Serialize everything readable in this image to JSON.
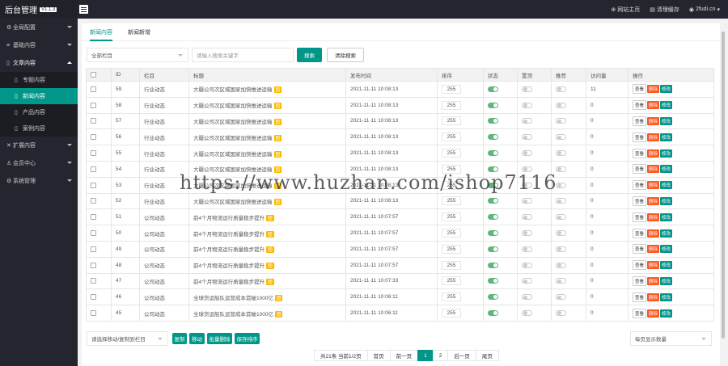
{
  "header": {
    "logo_text": "后台管理",
    "version": "V1.1.3",
    "links": [
      {
        "icon": "globe-icon",
        "label": "网站主页"
      },
      {
        "icon": "clear-icon",
        "label": "清理缓存"
      },
      {
        "icon": "user-icon",
        "label": "2fudi.cn"
      }
    ]
  },
  "sidebar": {
    "items": [
      {
        "icon": "gear-icon",
        "label": "全局配置"
      },
      {
        "icon": "sliders-icon",
        "label": "基础内容"
      },
      {
        "icon": "document-icon",
        "label": "文章内容"
      },
      {
        "icon": "expand-icon",
        "label": "扩展内容"
      },
      {
        "icon": "member-icon",
        "label": "会员中心"
      },
      {
        "icon": "settings-icon",
        "label": "系统管理"
      }
    ],
    "sub_items": [
      "专题内容",
      "新闻内容",
      "产品内容",
      "案例内容"
    ]
  },
  "tabs": [
    "新闻内容",
    "新闻新增"
  ],
  "filter": {
    "category_select": "全部栏目",
    "search_placeholder": "请输入搜索关键字",
    "search_button": "搜索",
    "clear_button": "清除搜索"
  },
  "table": {
    "headers": [
      "",
      "ID",
      "栏目",
      "标题",
      "发布时间",
      "排序",
      "状态",
      "置顶",
      "推荐",
      "访问量",
      "操作"
    ],
    "rows": [
      {
        "id": "59",
        "cat": "行业动态",
        "title": "大疆公司次区域国家加快推进运输",
        "time": "2021-11-11 10:08:13",
        "sort": "255",
        "status": "on",
        "top": "off",
        "rec": "off",
        "views": "11"
      },
      {
        "id": "58",
        "cat": "行业动态",
        "title": "大疆公司次区域国家加快推进运输",
        "time": "2021-11-11 10:08:13",
        "sort": "255",
        "status": "on",
        "top": "off",
        "rec": "off",
        "views": "0"
      },
      {
        "id": "57",
        "cat": "行业动态",
        "title": "大疆公司次区域国家加快推进运输",
        "time": "2021-11-11 10:08:13",
        "sort": "255",
        "status": "on",
        "top": "off",
        "rec": "off",
        "views": "0"
      },
      {
        "id": "56",
        "cat": "行业动态",
        "title": "大疆公司次区域国家加快推进运输",
        "time": "2021-11-11 10:08:13",
        "sort": "255",
        "status": "on",
        "top": "off",
        "rec": "off",
        "views": "0"
      },
      {
        "id": "55",
        "cat": "行业动态",
        "title": "大疆公司次区域国家加快推进运输",
        "time": "2021-11-11 10:08:13",
        "sort": "255",
        "status": "on",
        "top": "off",
        "rec": "off",
        "views": "0"
      },
      {
        "id": "54",
        "cat": "行业动态",
        "title": "大疆公司次区域国家加快推进运输",
        "time": "2021-11-11 10:08:13",
        "sort": "255",
        "status": "on",
        "top": "off",
        "rec": "off",
        "views": "0"
      },
      {
        "id": "53",
        "cat": "行业动态",
        "title": "大疆公司次区域国家加快推进运输",
        "time": "2021-11-11 10:08:13",
        "sort": "255",
        "status": "on",
        "top": "off",
        "rec": "off",
        "views": "0"
      },
      {
        "id": "52",
        "cat": "行业动态",
        "title": "大疆公司次区域国家加快推进运输",
        "time": "2021-11-11 10:08:13",
        "sort": "255",
        "status": "on",
        "top": "off",
        "rec": "off",
        "views": "0"
      },
      {
        "id": "51",
        "cat": "公司动态",
        "title": "前4个月物流运行质量稳步提升",
        "time": "2021-11-11 10:07:57",
        "sort": "255",
        "status": "on",
        "top": "off",
        "rec": "off",
        "views": "0"
      },
      {
        "id": "50",
        "cat": "公司动态",
        "title": "前4个月物流运行质量稳步提升",
        "time": "2021-11-11 10:07:57",
        "sort": "255",
        "status": "on",
        "top": "off",
        "rec": "off",
        "views": "0"
      },
      {
        "id": "49",
        "cat": "公司动态",
        "title": "前4个月物流运行质量稳步提升",
        "time": "2021-11-11 10:07:57",
        "sort": "255",
        "status": "on",
        "top": "off",
        "rec": "off",
        "views": "0"
      },
      {
        "id": "48",
        "cat": "公司动态",
        "title": "前4个月物流运行质量稳步提升",
        "time": "2021-11-11 10:07:57",
        "sort": "255",
        "status": "on",
        "top": "off",
        "rec": "off",
        "views": "0"
      },
      {
        "id": "47",
        "cat": "公司动态",
        "title": "前4个月物流运行质量稳步提升",
        "time": "2021-11-11 10:07:33",
        "sort": "255",
        "status": "on",
        "top": "off",
        "rec": "off",
        "views": "0"
      },
      {
        "id": "46",
        "cat": "公司动态",
        "title": "全球货运船队运营成本首破1000亿",
        "time": "2021-11-11 10:06:11",
        "sort": "255",
        "status": "on",
        "top": "off",
        "rec": "off",
        "views": "0"
      },
      {
        "id": "45",
        "cat": "公司动态",
        "title": "全球货运船队运营成本首破1000亿",
        "time": "2021-11-11 10:06:11",
        "sort": "255",
        "status": "on",
        "top": "off",
        "rec": "off",
        "views": "0"
      }
    ],
    "badge": "图",
    "actions": [
      "查看",
      "删除",
      "修改"
    ]
  },
  "bulk": {
    "select_placeholder": "请选择移动/复制到栏目",
    "buttons": [
      "复制",
      "移动",
      "批量删除",
      "保存排序"
    ],
    "per_page": "每页显示数量"
  },
  "pager": {
    "info": "共21条 当前1/2页",
    "first": "首页",
    "prev": "前一页",
    "pages": [
      "1",
      "2"
    ],
    "next": "后一页",
    "last": "尾页"
  },
  "watermark": "https://www.huzhan.com/ishop7116",
  "colors": {
    "accent": "#009688",
    "danger": "#ff5722",
    "badge": "#ffb800",
    "dark": "#23262e"
  }
}
